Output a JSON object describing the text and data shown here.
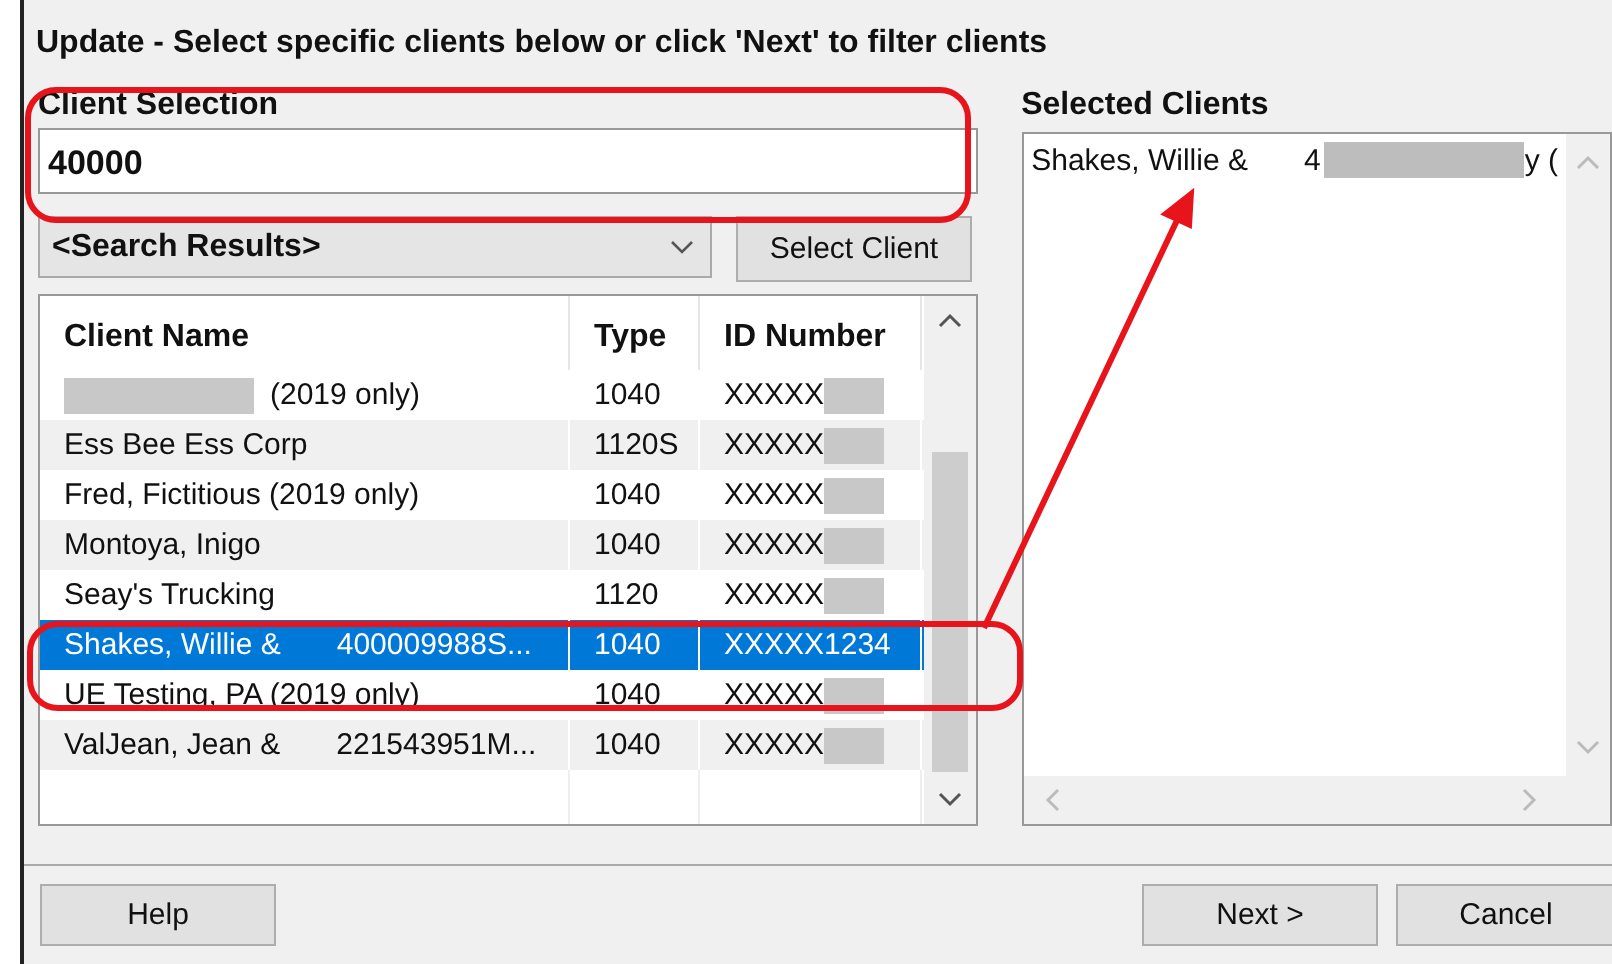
{
  "window": {
    "title": "Update - Select specific clients below or click 'Next' to filter clients"
  },
  "client_selection": {
    "label": "Client Selection",
    "value": "40000"
  },
  "search_dropdown": {
    "value": "<Search Results>"
  },
  "select_client_button": "Select Client",
  "table": {
    "columns": [
      "Client Name",
      "Type",
      "ID Number"
    ],
    "rows": [
      {
        "name_redacted": true,
        "name": "(2019 only)",
        "type": "1040",
        "id": "XXXXX",
        "id_redacted": true,
        "selected": false
      },
      {
        "name_redacted": false,
        "name": "Ess Bee Ess Corp",
        "type": "1120S",
        "id": "XXXXX",
        "id_redacted": true,
        "selected": false
      },
      {
        "name_redacted": false,
        "name": "Fred, Fictitious (2019 only)",
        "type": "1040",
        "id": "XXXXX",
        "id_redacted": true,
        "selected": false
      },
      {
        "name_redacted": false,
        "name": "Montoya, Inigo",
        "type": "1040",
        "id": "XXXXX",
        "id_redacted": true,
        "selected": false
      },
      {
        "name_redacted": false,
        "name": "Seay's Trucking",
        "type": "1120",
        "id": "XXXXX",
        "id_redacted": true,
        "selected": false
      },
      {
        "name_redacted": false,
        "name": "Shakes, Willie &",
        "detail": "400009988S...",
        "type": "1040",
        "id": "XXXXX1234",
        "id_redacted": false,
        "selected": true
      },
      {
        "name_redacted": false,
        "name": "UE Testing, PA (2019 only)",
        "type": "1040",
        "id": "XXXXX",
        "id_redacted": true,
        "selected": false
      },
      {
        "name_redacted": false,
        "name": "ValJean, Jean &",
        "detail": "221543951M...",
        "type": "1040",
        "id": "XXXXX",
        "id_redacted": true,
        "selected": false
      }
    ]
  },
  "selected_clients": {
    "label": "Selected Clients",
    "items": [
      {
        "name": "Shakes, Willie &",
        "detail_start": "4",
        "detail_end": "y (",
        "redacted": true
      }
    ]
  },
  "buttons": {
    "help": "Help",
    "next": "Next >",
    "cancel": "Cancel"
  }
}
